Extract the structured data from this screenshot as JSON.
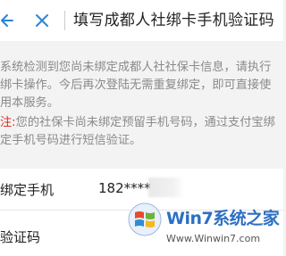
{
  "header": {
    "title": "填写成都人社绑卡手机验证码",
    "back_icon": "arrow-left-icon",
    "close_icon": "close-icon",
    "icon_color": "#2b84d6"
  },
  "notice": {
    "line1": "系统检测到您尚未绑定成都人社社保卡信息，请执行绑卡操作。今后再次登陆无需重复绑定，即可直接使用本服务。",
    "warning_label": "注:",
    "warning_text": "您的社保卡尚未绑定预留手机号码，通过支付宝绑定手机号码进行短信验证。"
  },
  "form": {
    "phone_label": "绑定手机",
    "phone_value": "182****",
    "code_label": "验证码"
  },
  "watermark": {
    "brand": "Win7系统之家",
    "url": "Www.Winwin7.com"
  }
}
